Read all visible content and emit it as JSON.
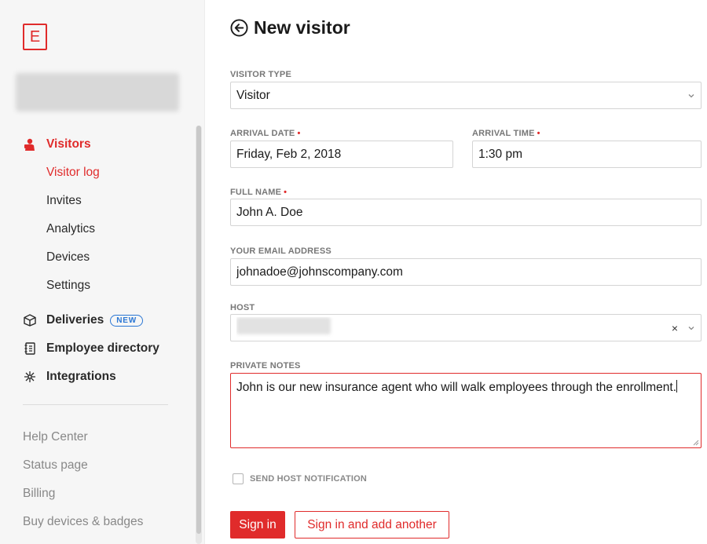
{
  "brand": {
    "logo_letter": "E",
    "accent": "#e02b2b",
    "badge_color": "#2a76d4"
  },
  "sidebar": {
    "nav": [
      {
        "label": "Visitors",
        "icon": "visitor-icon",
        "active": true
      },
      {
        "label": "Deliveries",
        "icon": "package-icon",
        "badge": "NEW"
      },
      {
        "label": "Employee directory",
        "icon": "directory-icon"
      },
      {
        "label": "Integrations",
        "icon": "integrations-icon"
      }
    ],
    "visitors_sub": [
      {
        "label": "Visitor log",
        "active": true
      },
      {
        "label": "Invites"
      },
      {
        "label": "Analytics"
      },
      {
        "label": "Devices"
      },
      {
        "label": "Settings"
      }
    ],
    "footer": [
      {
        "label": "Help Center"
      },
      {
        "label": "Status page"
      },
      {
        "label": "Billing"
      },
      {
        "label": "Buy devices & badges"
      }
    ]
  },
  "form": {
    "title": "New visitor",
    "visitor_type": {
      "label": "VISITOR TYPE",
      "value": "Visitor"
    },
    "arrival_date": {
      "label": "ARRIVAL DATE",
      "value": "Friday, Feb 2, 2018"
    },
    "arrival_time": {
      "label": "ARRIVAL TIME",
      "value": "1:30 pm"
    },
    "full_name": {
      "label": "FULL NAME",
      "value": "John A. Doe"
    },
    "email": {
      "label": "YOUR EMAIL ADDRESS",
      "value": "johnadoe@johnscompany.com"
    },
    "host": {
      "label": "HOST",
      "clear": "×"
    },
    "private_notes": {
      "label": "PRIVATE NOTES",
      "value": "John is our new insurance agent who will walk employees through the enrollment."
    },
    "send_notification": {
      "label": "SEND HOST NOTIFICATION",
      "checked": false
    },
    "required_mark": "•",
    "sign_in": "Sign in",
    "sign_in_another": "Sign in and add another"
  }
}
